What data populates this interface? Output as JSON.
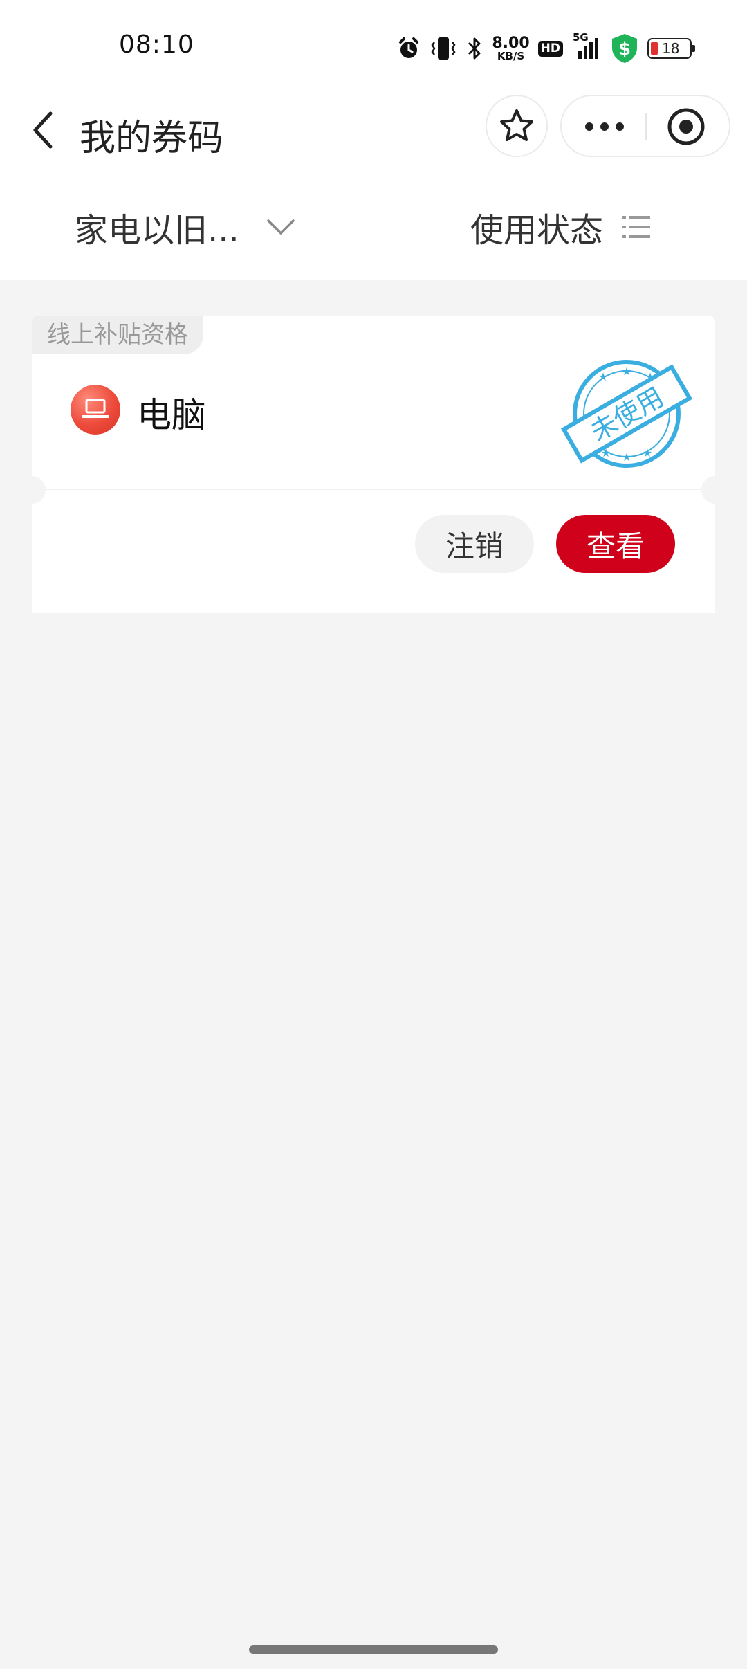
{
  "status_bar": {
    "time": "08:10",
    "net_speed_value": "8.00",
    "net_speed_unit": "KB/S",
    "hd_label": "HD",
    "network_label": "5G",
    "battery_level": "18",
    "icons": [
      "alarm-icon",
      "vibrate-icon",
      "bluetooth-icon",
      "signal-icon",
      "security-shield-icon",
      "battery-icon"
    ],
    "battery_color": "#e03131",
    "shield_color": "#1fb35a"
  },
  "nav": {
    "title": "我的券码"
  },
  "filters": {
    "category_label": "家电以旧...",
    "status_label": "使用状态"
  },
  "voucher": {
    "tag": "线上补贴资格",
    "product_name": "电脑",
    "stamp_text": "未使用",
    "stamp_color": "#3aaee0",
    "cancel_label": "注销",
    "view_label": "查看",
    "accent_color": "#d0021b"
  }
}
